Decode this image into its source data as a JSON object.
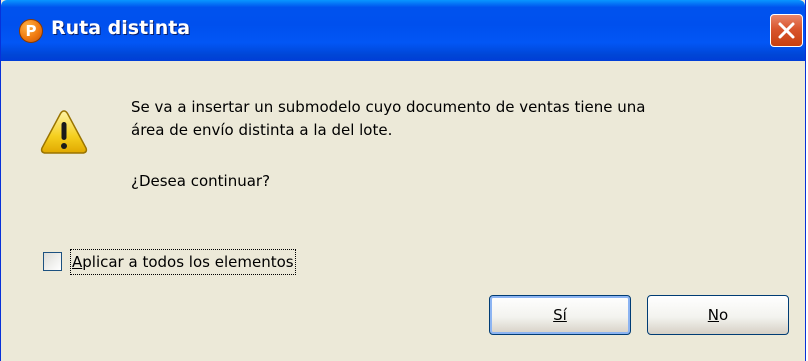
{
  "window": {
    "title": "Ruta distinta",
    "app_icon_letter": "P",
    "close_icon": "close-icon"
  },
  "message": {
    "line1": "Se va a insertar un submodelo cuyo documento de ventas tiene una",
    "line2": "área de envío distinta a la del lote.",
    "question": "¿Desea continuar?",
    "icon": "warning-icon"
  },
  "checkbox": {
    "label": "Aplicar a todos los elementos",
    "checked": false
  },
  "buttons": {
    "yes_label": "Sí",
    "no_label": "No"
  },
  "colors": {
    "titlebar": "#0053ee",
    "dialog_bg": "#ece9d8",
    "close_button": "#d9552d"
  }
}
